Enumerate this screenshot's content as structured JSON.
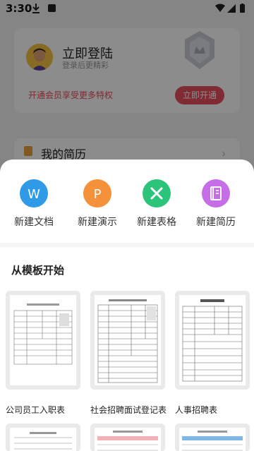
{
  "status_bar": {
    "time": "3:30"
  },
  "profile": {
    "login_title": "立即登陆",
    "login_subtitle": "登录后更精彩",
    "vip_promo": "开通会员享受更多特权",
    "vip_button": "立即开通"
  },
  "menu": {
    "resume_label": "我的简历"
  },
  "sheet": {
    "actions": [
      {
        "label": "新建文档",
        "letter": "W",
        "color": "#2f9ae8",
        "icon": "word-doc-icon"
      },
      {
        "label": "新建演示",
        "letter": "P",
        "color": "#f4913a",
        "icon": "presentation-icon"
      },
      {
        "label": "新建表格",
        "letter": "X",
        "color": "#2cc47a",
        "icon": "spreadsheet-icon"
      },
      {
        "label": "新建简历",
        "letter": "",
        "color": "#c66ee8",
        "icon": "resume-notebook-icon"
      }
    ],
    "section_title": "从模板开始",
    "templates": [
      {
        "title": "公司员工入职表"
      },
      {
        "title": "社会招聘面试登记表"
      },
      {
        "title": "人事招聘表"
      }
    ]
  }
}
